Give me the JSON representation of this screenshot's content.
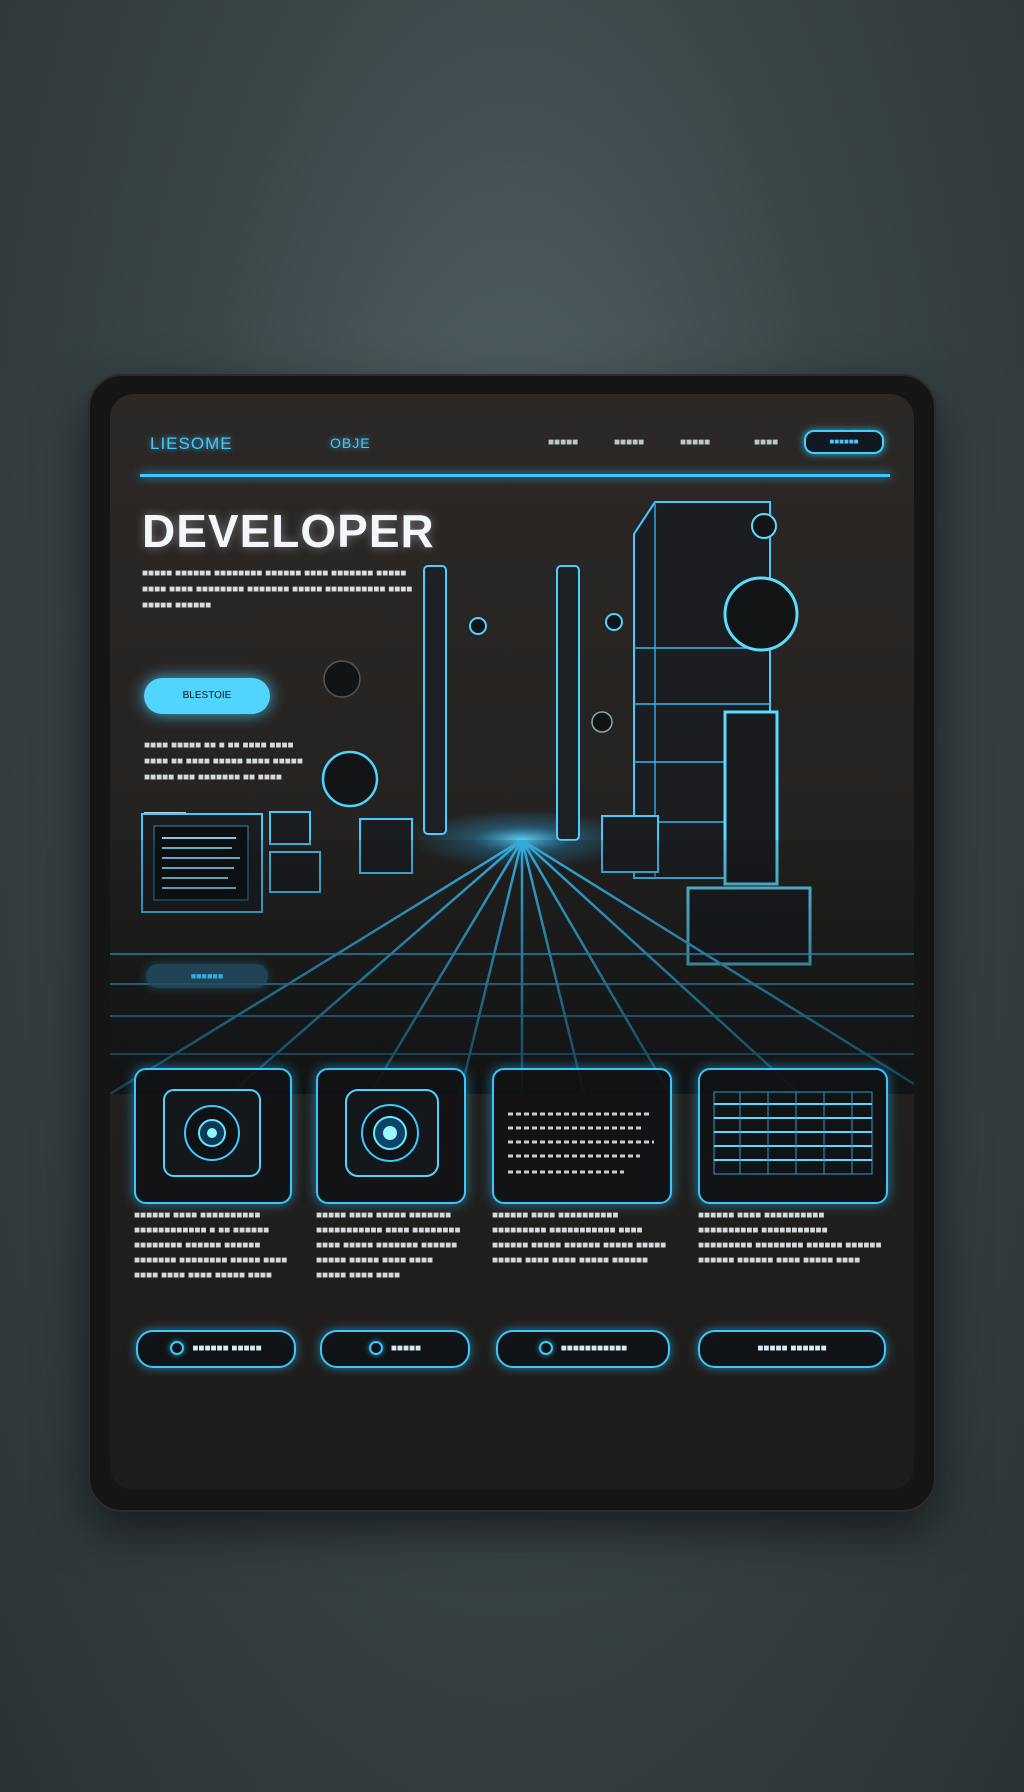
{
  "brand": {
    "logo": "LIESOME",
    "tag": "OBJE"
  },
  "nav": {
    "menu": [
      "■■■■■",
      "■■■■■",
      "■■■■■",
      "■■■■"
    ],
    "cta": "■■■■■■"
  },
  "hero": {
    "title": "DEVELOPER",
    "body": "■■■■■ ■■■■■■ ■■■■■■■■ ■■■■■■ ■■■■ ■■■■■■■ ■■■■■ ■■■■ ■■■■ ■■■■■■■■ ■■■■■■■ ■■■■■ ■■■■■■■■■■ ■■■■ ■■■■■ ■■■■■■",
    "primary_button": "BLESTOIE",
    "note": "■■■■ ■■■■■ ■■ ■ ■■ ■■■■ ■■■■ ■■■■ ■■ ■■■■ ■■■■■ ■■■■ ■■■■■ ■■■■■ ■■■ ■■■■■■■ ■■ ■■■■",
    "secondary_button": "■■■■■■"
  },
  "cards": [
    {
      "icon": "camera-lens-icon",
      "text": "■■■■■■ ■■■■ ■■■■■■■■■■ ■■■■■■■■■■■■ ■ ■■ ■■■■■■ ■■■■■■■■ ■■■■■■ ■■■■■■ ■■■■■■■ ■■■■■■■■ ■■■■■ ■■■■ ■■■■ ■■■■ ■■■■ ■■■■■ ■■■■",
      "button": "■■■■■■ ■■■■■"
    },
    {
      "icon": "glowing-orb-icon",
      "text": "■■■■■ ■■■■ ■■■■■ ■■■■■■■ ■■■■■■■■■■■ ■■■■ ■■■■■■■■ ■■■■ ■■■■■ ■■■■■■■ ■■■■■■ ■■■■■ ■■■■■ ■■■■ ■■■■ ■■■■■ ■■■■ ■■■■",
      "button": "■■■■■"
    },
    {
      "icon": "document-icon",
      "text": "■■■■■■ ■■■■ ■■■■■■■■■■ ■■■■■■■■■ ■■■■■■■■■■■ ■■■■ ■■■■■■ ■■■■■ ■■■■■■ ■■■■■ ■■■■■ ■■■■■ ■■■■ ■■■■ ■■■■■ ■■■■■■",
      "button": "■■■■■■■■■■■"
    },
    {
      "icon": "spreadsheet-icon",
      "text": "■■■■■■ ■■■■ ■■■■■■■■■■ ■■■■■■■■■■ ■■■■■■■■■■■ ■■■■■■■■■ ■■■■■■■■ ■■■■■■ ■■■■■■ ■■■■■■ ■■■■■■ ■■■■ ■■■■■ ■■■■",
      "button": "■■■■■ ■■■■■■"
    }
  ],
  "colors": {
    "accent": "#39c8ff",
    "background": "#242220",
    "text": "#d4d9dc"
  }
}
